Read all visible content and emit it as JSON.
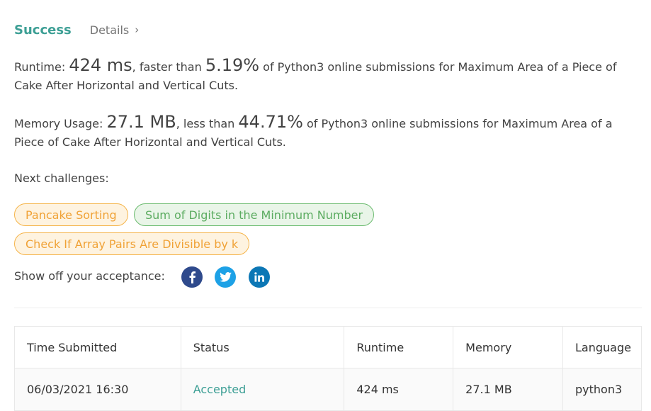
{
  "header": {
    "status": "Success",
    "details_label": "Details",
    "chevron": "›"
  },
  "runtime": {
    "label": "Runtime: ",
    "value": "424 ms",
    "compare": ", faster than ",
    "percent": "5.19%",
    "suffix": " of Python3 online submissions for Maximum Area of a Piece of Cake After Horizontal and Vertical Cuts."
  },
  "memory": {
    "label": "Memory Usage: ",
    "value": "27.1 MB",
    "compare": ", less than ",
    "percent": "44.71%",
    "suffix": " of Python3 online submissions for Maximum Area of a Piece of Cake After Horizontal and Vertical Cuts."
  },
  "next": {
    "label": "Next challenges:",
    "challenges": [
      {
        "title": "Pancake Sorting",
        "difficulty": "medium"
      },
      {
        "title": "Sum of Digits in the Minimum Number",
        "difficulty": "easy"
      },
      {
        "title": "Check If Array Pairs Are Divisible by k",
        "difficulty": "medium"
      }
    ]
  },
  "share": {
    "label": "Show off your acceptance:",
    "icons": [
      "facebook-icon",
      "twitter-icon",
      "linkedin-icon"
    ],
    "colors": {
      "facebook": "#2f4a8c",
      "twitter": "#1da1e6",
      "linkedin": "#0c77b5"
    }
  },
  "table": {
    "headers": [
      "Time Submitted",
      "Status",
      "Runtime",
      "Memory",
      "Language"
    ],
    "rows": [
      [
        "06/03/2021 16:30",
        "Accepted",
        "424 ms",
        "27.1 MB",
        "python3"
      ]
    ]
  },
  "colors": {
    "accent": "#3d9f95",
    "medium_tag": "#f0a236",
    "easy_tag": "#5cac61"
  }
}
